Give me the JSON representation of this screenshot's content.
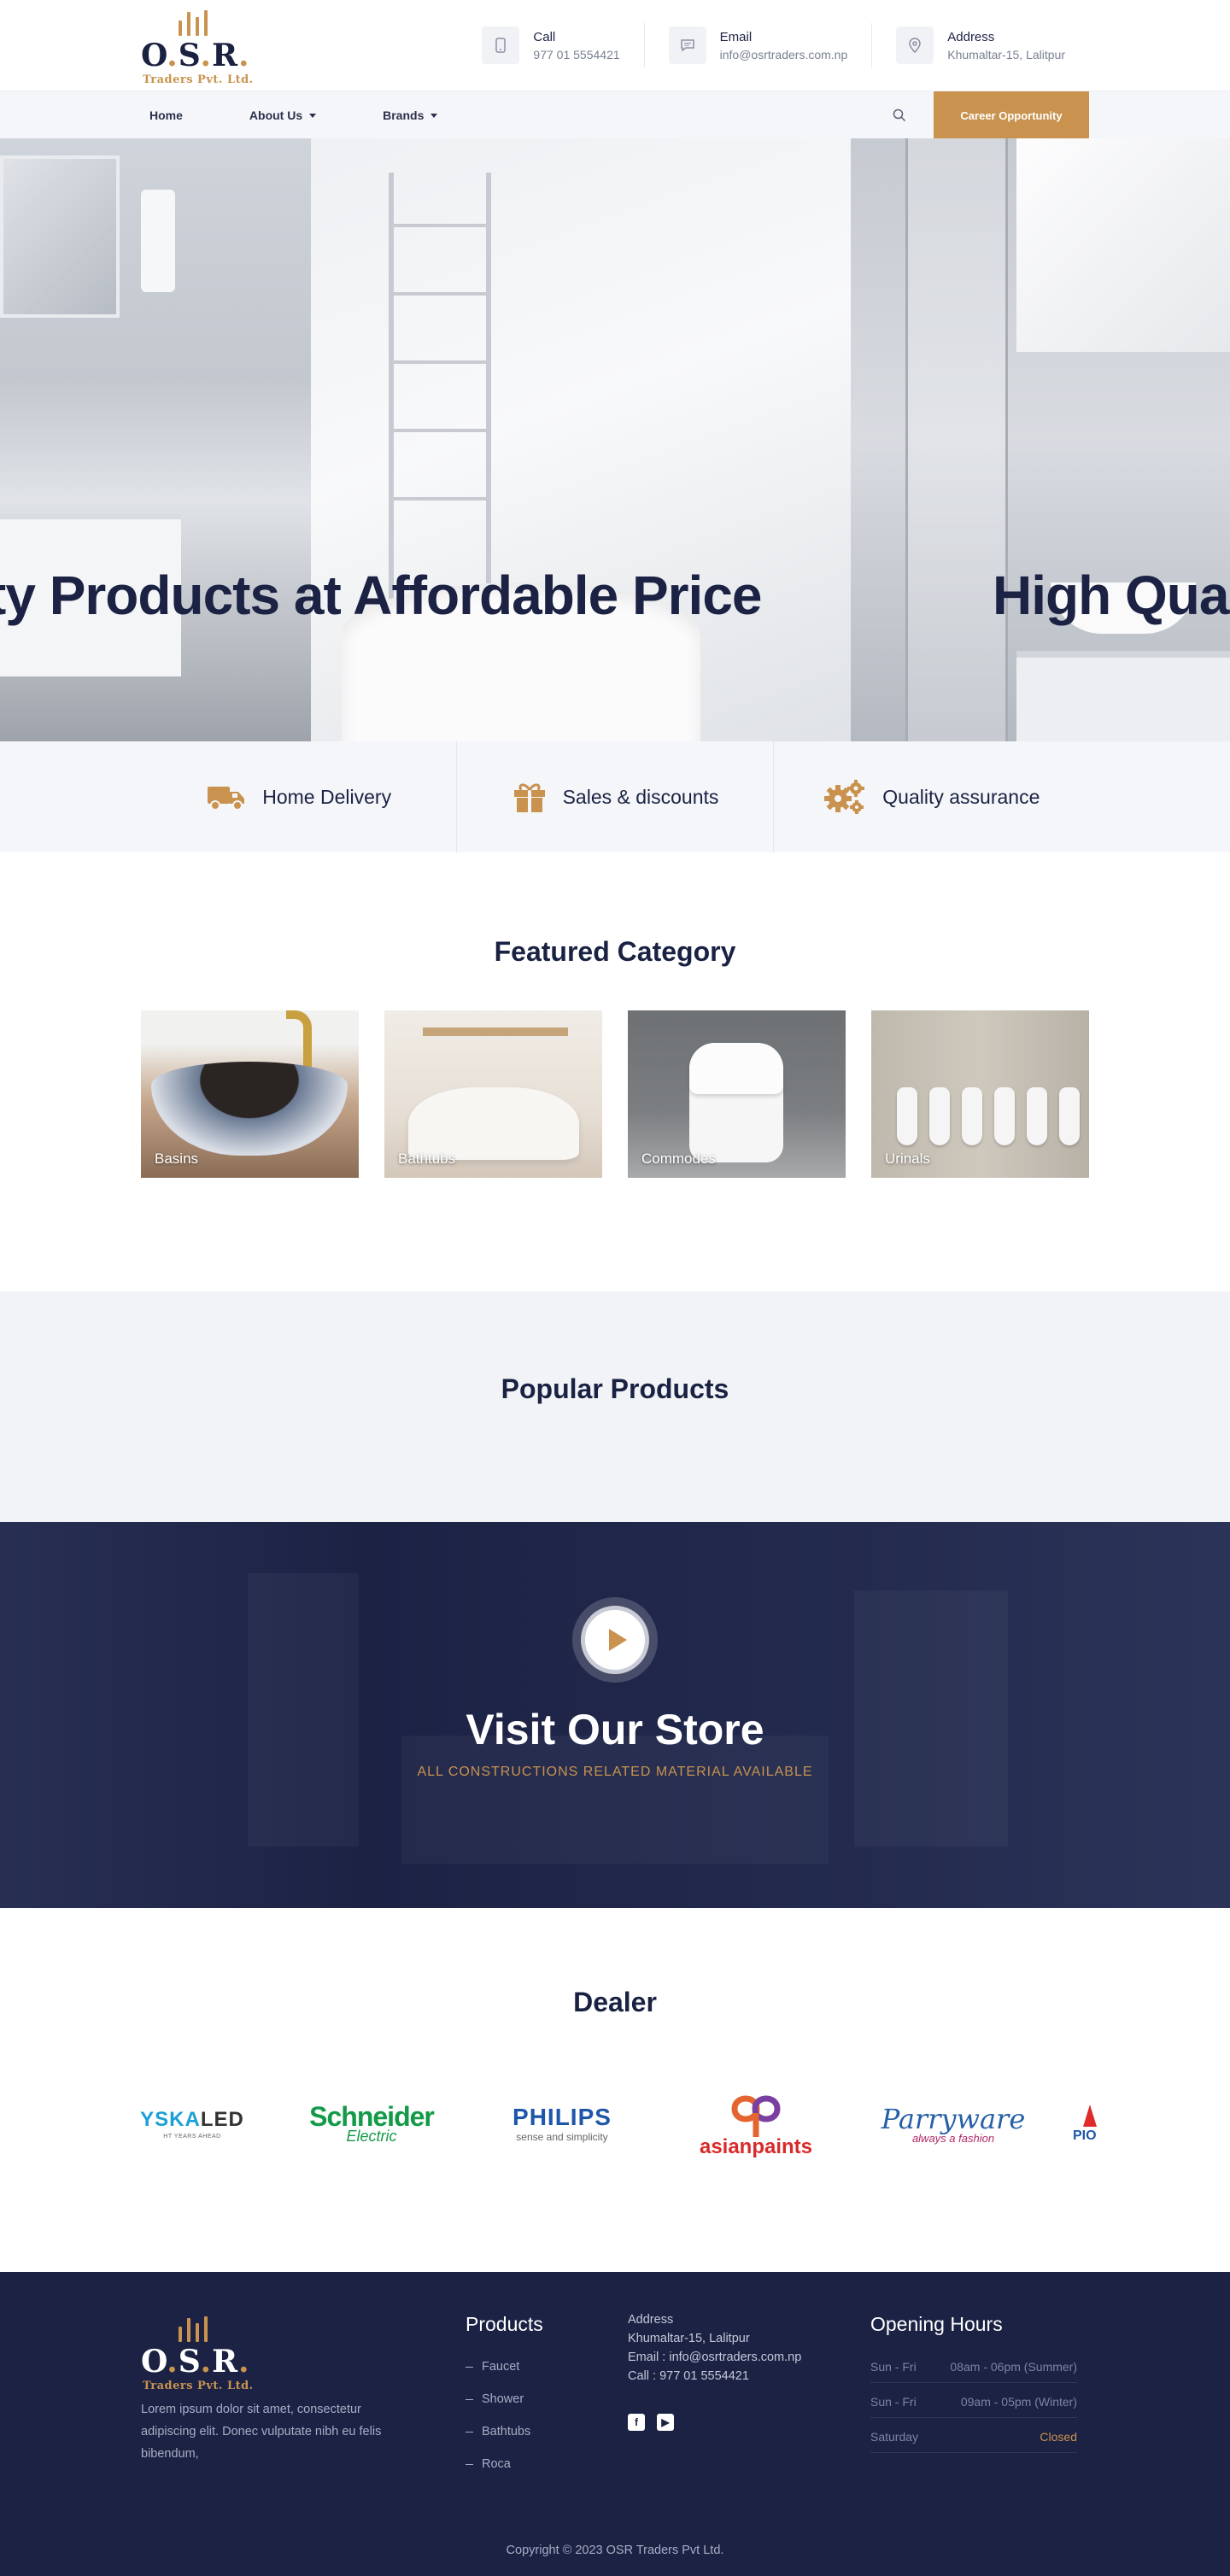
{
  "brand": {
    "logo_text": "O.S.R.",
    "logo_sub": "Traders Pvt. Ltd."
  },
  "contacts": [
    {
      "label": "Call",
      "value": "977 01 5554421",
      "icon": "phone-icon"
    },
    {
      "label": "Email",
      "value": "info@osrtraders.com.np",
      "icon": "chat-icon"
    },
    {
      "label": "Address",
      "value": "Khumaltar-15, Lalitpur",
      "icon": "location-pin-icon"
    }
  ],
  "nav": {
    "items": [
      "Home",
      "About Us",
      "Brands"
    ],
    "career_label": "Career Opportunity"
  },
  "hero": {
    "title": "ty Products at Affordable Price",
    "title_next": "High Qualit"
  },
  "features": [
    {
      "label": "Home Delivery",
      "icon": "delivery-truck-icon"
    },
    {
      "label": "Sales & discounts",
      "icon": "gift-icon"
    },
    {
      "label": "Quality assurance",
      "icon": "gears-icon"
    }
  ],
  "featured": {
    "title": "Featured Category",
    "categories": [
      "Basins",
      "Bathtubs",
      "Commodes",
      "Urinals"
    ]
  },
  "popular": {
    "title": "Popular Products"
  },
  "video": {
    "title": "Visit Our Store",
    "subtitle": "ALL CONSTRUCTIONS RELATED MATERIAL AVAILABLE"
  },
  "dealer": {
    "title": "Dealer",
    "brands": [
      {
        "main": "YSKA",
        "suffix": "LED",
        "tag": "HT YEARS AHEAD"
      },
      {
        "main": "Schneider",
        "sub": "Electric"
      },
      {
        "main": "PHILIPS",
        "sub": "sense and simplicity"
      },
      {
        "main": "asianpaints"
      },
      {
        "main": "Parryware",
        "sub": "always a fashion"
      },
      {
        "main": "PIO"
      }
    ]
  },
  "footer": {
    "about": "Lorem ipsum dolor sit amet, consectetur adipiscing elit. Donec vulputate nibh eu felis bibendum,",
    "products_title": "Products",
    "products": [
      "Faucet",
      "Shower",
      "Bathtubs",
      "Roca"
    ],
    "address_title": "Address",
    "address_lines": [
      "Khumaltar-15, Lalitpur",
      "Email : info@osrtraders.com.np",
      "Call : 977 01 5554421"
    ],
    "hours_title": "Opening Hours",
    "hours": [
      {
        "days": "Sun - Fri",
        "time": "08am - 06pm (Summer)"
      },
      {
        "days": "Sun - Fri",
        "time": "09am - 05pm (Winter)"
      },
      {
        "days": "Saturday",
        "time": "Closed"
      }
    ],
    "copyright": "Copyright © 2023 OSR Traders Pvt Ltd."
  },
  "colors": {
    "accent": "#c9934f",
    "navy": "#1c2244"
  }
}
